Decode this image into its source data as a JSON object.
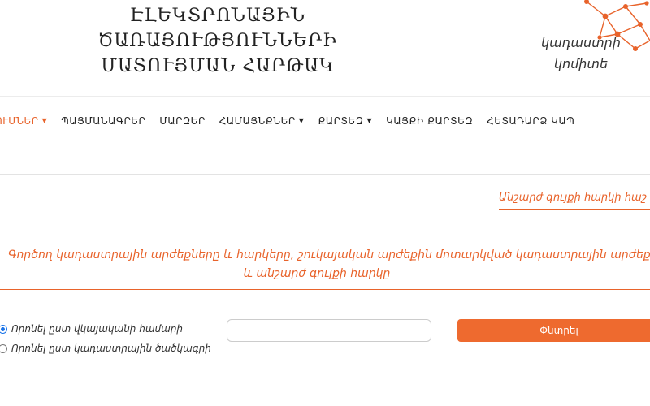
{
  "header": {
    "title_line1": "ԷԼԵԿՏՐՈՆԱՅԻՆ ԾԱՌԱՅՈՒԹՅՈՒՆՆԵՐԻ",
    "title_line2": "ՄԱՏՈՒՅՄԱՆ ՀԱՐԹԱԿ",
    "logo_line1": "կադաստրի",
    "logo_line2": "կոմիտե"
  },
  "colors": {
    "accent": "#e8632b",
    "button": "#ee6a2f",
    "radio_selected": "#1a73e8"
  },
  "nav": {
    "items": [
      {
        "label": "ՈՒՄՆԵՐ",
        "has_dropdown": true,
        "active": true
      },
      {
        "label": "ՊԱՅՄԱՆԱԳՐԵՐ",
        "has_dropdown": false
      },
      {
        "label": "ՄԱՐԶԵՐ",
        "has_dropdown": false
      },
      {
        "label": "ՀԱՄԱՅՆՔՆԵՐ",
        "has_dropdown": true
      },
      {
        "label": "ՔԱՐՏԵԶ",
        "has_dropdown": true
      },
      {
        "label": "ԿԱՅՔԻ ՔԱՐՏԵԶ",
        "has_dropdown": false
      },
      {
        "label": "ՀԵՏԱԴԱՐՁ ԿԱՊ",
        "has_dropdown": false
      }
    ],
    "caret": "▼"
  },
  "content": {
    "map_link": "Անշարժ գույքի հարկի հաշ",
    "info_line1": "Գործող կադաստրային արժեքները և հարկերը, շուկայական արժեքին մոտարկված կադաստրային արժեք",
    "info_line2": "և անշարժ գույքի հարկը"
  },
  "search": {
    "options": [
      {
        "label": "Որոնել ըստ վկայականի համարի",
        "selected": true
      },
      {
        "label": "Որոնել ըստ կադաստրային ծածկագրի",
        "selected": false
      }
    ],
    "input_value": "",
    "input_placeholder": "",
    "button_label": "Փնտրել"
  }
}
